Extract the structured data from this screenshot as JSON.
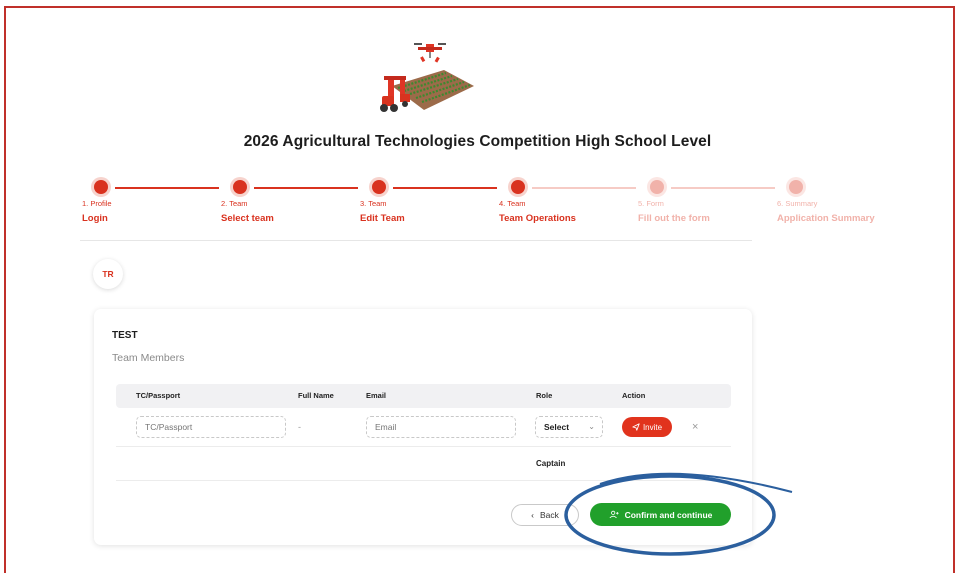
{
  "page": {
    "title": "2026 Agricultural Technologies Competition High School Level",
    "logo_icon": "agricultural-robot-logo-icon"
  },
  "stepper": {
    "steps": [
      {
        "number": "1. Profile",
        "label": "Login",
        "state": "done"
      },
      {
        "number": "2. Team",
        "label": "Select team",
        "state": "done"
      },
      {
        "number": "3. Team",
        "label": "Edit Team",
        "state": "done"
      },
      {
        "number": "4. Team",
        "label": "Team Operations",
        "state": "active"
      },
      {
        "number": "5. Form",
        "label": "Fill out the form",
        "state": "todo"
      },
      {
        "number": "6. Summary",
        "label": "Application Summary",
        "state": "todo"
      }
    ]
  },
  "avatar": {
    "initials": "TR"
  },
  "team": {
    "name": "TEST",
    "subtitle": "Team Members",
    "columns": [
      "TC/Passport",
      "Full Name",
      "Email",
      "Role",
      "Action"
    ],
    "new_member": {
      "tc_placeholder": "TC/Passport",
      "full_name": "-",
      "email_placeholder": "Email",
      "role_value": "Select",
      "invite_label": "Invite",
      "remove_icon": "close-icon"
    },
    "members": [
      {
        "role": "Captain"
      }
    ]
  },
  "actions": {
    "back_label": "Back",
    "confirm_label": "Confirm and continue"
  },
  "colors": {
    "accent": "#d9321f",
    "accent_muted": "#f1b2aa",
    "confirm_green": "#21a02b",
    "annotation_blue": "#2b5f9e",
    "frame": "#c0302a"
  }
}
